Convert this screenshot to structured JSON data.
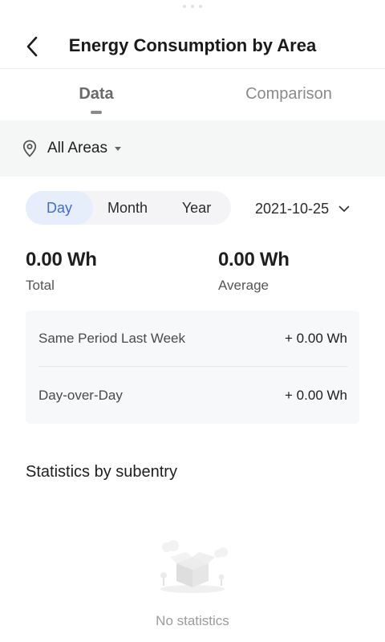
{
  "header": {
    "title": "Energy Consumption by Area",
    "back_icon": "chevron-left-icon"
  },
  "tabs": [
    {
      "label": "Data",
      "active": true
    },
    {
      "label": "Comparison",
      "active": false
    }
  ],
  "area_selector": {
    "icon": "location-pin-icon",
    "label": "All Areas",
    "caret_icon": "caret-down-icon"
  },
  "period": {
    "options": [
      "Day",
      "Month",
      "Year"
    ],
    "selected": "Day",
    "date": "2021-10-25",
    "date_icon": "chevron-down-icon"
  },
  "stats": {
    "total_value": "0.00 Wh",
    "total_label": "Total",
    "average_value": "0.00 Wh",
    "average_label": "Average"
  },
  "comparisons": [
    {
      "label": "Same Period Last Week",
      "value": "+ 0.00 Wh"
    },
    {
      "label": "Day-over-Day",
      "value": "+ 0.00 Wh"
    }
  ],
  "subentry": {
    "title": "Statistics by subentry",
    "empty_icon": "empty-box-icon",
    "empty_text": "No statistics"
  },
  "colors": {
    "accent": "#3d6fd2",
    "accent_bg": "#e6eefb",
    "bar_bg": "#f5f6f6",
    "card_bg": "#f7f8fa"
  }
}
